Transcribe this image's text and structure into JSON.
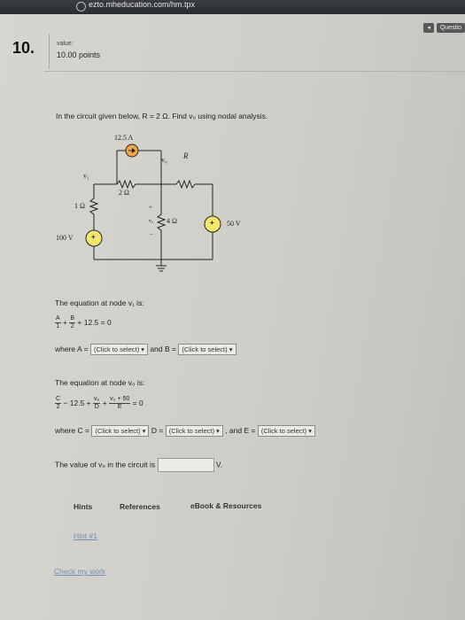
{
  "browser": {
    "url": "ezto.mheducation.com/hm.tpx"
  },
  "header": {
    "question_button": "Questio"
  },
  "question": {
    "number": "10.",
    "value_label": "value:",
    "points": "10.00 points",
    "prompt": "In the circuit given below, R = 2 Ω. Find v₀ using nodal analysis."
  },
  "circuit": {
    "current_source": "12.5 A",
    "v1_label": "v₁",
    "v0_label": "v₀",
    "r_label": "R",
    "r1_left": "1 Ω",
    "r_middle": "2 Ω",
    "r_four": "4 Ω",
    "v_source_left": "100 V",
    "v_source_right": "50 V",
    "plus": "+",
    "minus": "−",
    "vo_side": "v₀"
  },
  "eq1": {
    "title": "The equation at node v₁ is:",
    "a_num": "A",
    "a_den": "1",
    "b_num": "B",
    "b_den": "2",
    "tail": "+ 12.5 = 0",
    "where_a": "where A =",
    "select_a": "(Click to select)",
    "and_b": "and B =",
    "select_b": "(Click to select)"
  },
  "eq2": {
    "title": "The equation at node v₀ is:",
    "c_num": "C",
    "c_den": "2",
    "mid": "− 12.5 +",
    "d_num": "v₀",
    "d_den": "D",
    "e_num": "v₀ + 50",
    "e_den": "E",
    "tail": "= 0",
    "where_c": "where C =",
    "select_c": "(Click to select)",
    "d_label": "D =",
    "select_d": "(Click to select)",
    "and_e": ", and E =",
    "select_e": "(Click to select)"
  },
  "answer": {
    "text": "The value of v₀ in the circuit is",
    "unit": "V."
  },
  "footer": {
    "hints": "Hints",
    "references": "References",
    "ebook": "eBook & Resources",
    "hint1": "Hint #1",
    "check": "Check my work"
  }
}
